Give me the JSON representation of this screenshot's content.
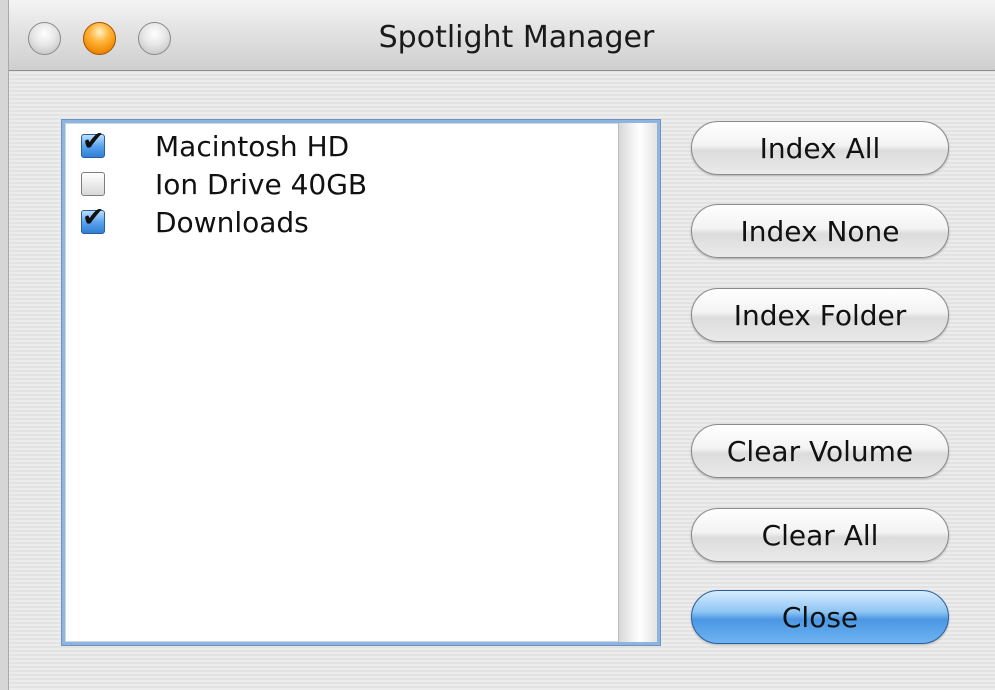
{
  "window": {
    "title": "Spotlight Manager"
  },
  "volumes": [
    {
      "label": "Macintosh HD",
      "checked": true
    },
    {
      "label": "Ion Drive 40GB",
      "checked": false
    },
    {
      "label": "Downloads",
      "checked": true
    }
  ],
  "buttons": {
    "index_all": "Index All",
    "index_none": "Index None",
    "index_folder": "Index Folder",
    "clear_volume": "Clear Volume",
    "clear_all": "Clear All",
    "close": "Close"
  },
  "checkmark": "✔",
  "colors": {
    "accent": "#4b97e3",
    "list_focus_ring": "#8fb4dd",
    "minimize_orange": "#f08a00"
  }
}
